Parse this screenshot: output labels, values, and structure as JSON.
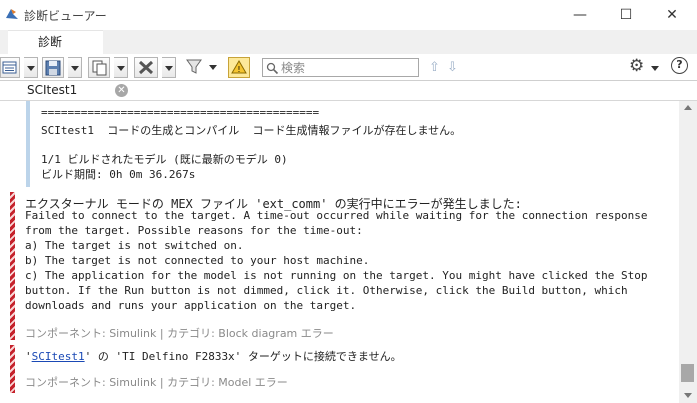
{
  "window": {
    "title": "診断ビューアー",
    "min_glyph": "—",
    "max_glyph": "☐",
    "close_glyph": "✕"
  },
  "ribbon": {
    "tab_label": "診断"
  },
  "toolbar": {
    "buttons": [
      "list-view-icon",
      "save-icon",
      "copy-icon",
      "clear-icon",
      "filter-icon",
      "warning-highlight-icon"
    ],
    "search_placeholder": "検索",
    "search_value": "",
    "prev_glyph": "⇧",
    "next_glyph": "⇩",
    "settings_glyph": "⚙",
    "help_glyph": "?"
  },
  "document_tab": {
    "label": "SCItest1",
    "close_glyph": "✕"
  },
  "content": {
    "info_block": {
      "separator": "==========================================",
      "line1": "SCItest1  コードの生成とコンパイル  コード生成情報ファイルが存在しません。",
      "line2": "1/1 ビルドされたモデル (既に最新のモデル 0)",
      "line3": "ビルド期間: 0h 0m 36.267s"
    },
    "error1": {
      "heading": "エクスターナル モードの MEX ファイル 'ext_comm' の実行中にエラーが発生しました:",
      "lines": [
        "Failed to connect to the target. A time-out occurred while waiting for the connection response",
        "from the target. Possible reasons for the time-out:",
        "a) The target is not switched on.",
        "b) The target is not connected to your host machine.",
        "c) The application for the model is not running on the target. You might have clicked the Stop",
        "button. If the Run button is not dimmed, click it. Otherwise, click the Build button, which",
        "downloads and runs your application on the target."
      ],
      "meta": "コンポーネント: Simulink | カテゴリ: Block diagram エラー"
    },
    "error2": {
      "quote_open": "'",
      "model_link": "SCItest1",
      "message_rest": "' の 'TI Delfino F2833x' ターゲットに接続できません。",
      "meta": "コンポーネント: Simulink | カテゴリ: Model エラー"
    }
  },
  "colors": {
    "error_stripe": "#c5212b",
    "info_bar": "#bcd4ea",
    "link": "#1a49b5",
    "meta_text": "#8a8a8a"
  }
}
